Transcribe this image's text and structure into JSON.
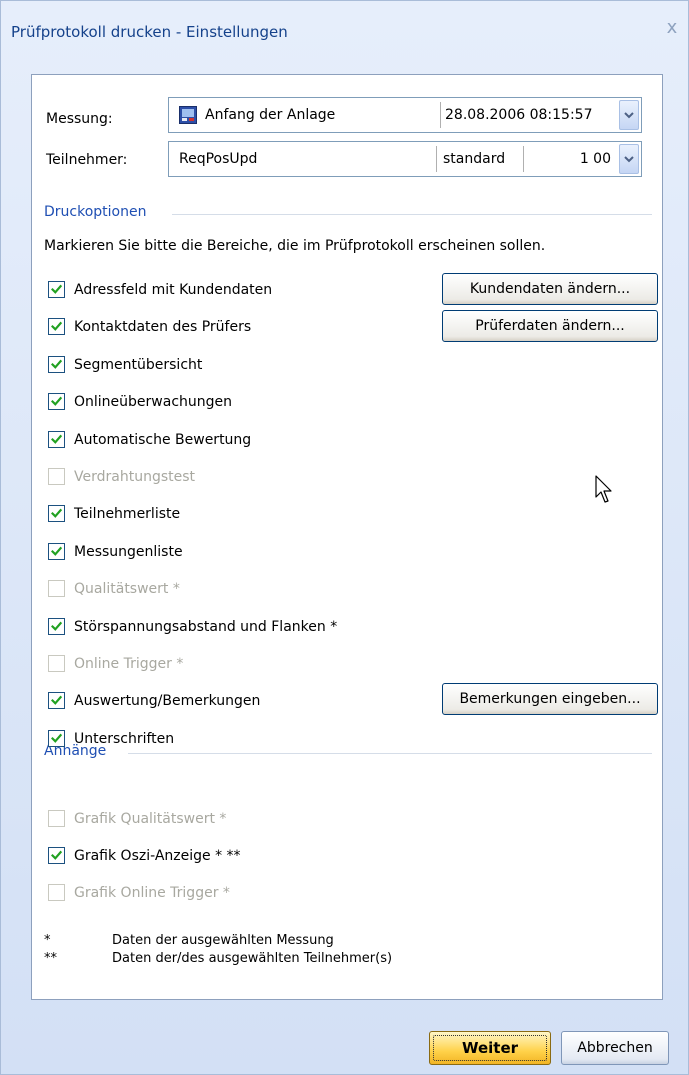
{
  "window": {
    "title": "Prüfprotokoll drucken - Einstellungen",
    "close_glyph": "x"
  },
  "messung": {
    "label": "Messung:",
    "name": "Anfang der Anlage",
    "datetime": "28.08.2006 08:15:57"
  },
  "teilnehmer": {
    "label": "Teilnehmer:",
    "name": "ReqPosUpd",
    "type": "standard",
    "value": "1 00"
  },
  "druckoptionen": {
    "heading": "Druckoptionen",
    "instruction": "Markieren Sie bitte die Bereiche, die im Prüfprotokoll erscheinen sollen.",
    "options": [
      {
        "label": "Adressfeld mit Kundendaten",
        "checked": true,
        "enabled": true
      },
      {
        "label": "Kontaktdaten des Prüfers",
        "checked": true,
        "enabled": true
      },
      {
        "label": "Segmentübersicht",
        "checked": true,
        "enabled": true
      },
      {
        "label": "Onlineüberwachungen",
        "checked": true,
        "enabled": true
      },
      {
        "label": "Automatische Bewertung",
        "checked": true,
        "enabled": true
      },
      {
        "label": "Verdrahtungstest",
        "checked": false,
        "enabled": false
      },
      {
        "label": "Teilnehmerliste",
        "checked": true,
        "enabled": true
      },
      {
        "label": "Messungenliste",
        "checked": true,
        "enabled": true
      },
      {
        "label": "Qualitätswert *",
        "checked": false,
        "enabled": false
      },
      {
        "label": "Störspannungsabstand und Flanken *",
        "checked": true,
        "enabled": true
      },
      {
        "label": "Online Trigger *",
        "checked": false,
        "enabled": false
      },
      {
        "label": "Auswertung/Bemerkungen",
        "checked": true,
        "enabled": true
      },
      {
        "label": "Unterschriften",
        "checked": true,
        "enabled": true
      }
    ],
    "buttons": {
      "kundendaten": "Kundendaten ändern...",
      "pruferdaten": "Prüferdaten ändern...",
      "bemerkungen": "Bemerkungen eingeben..."
    }
  },
  "anhaenge": {
    "heading": "Anhänge",
    "options": [
      {
        "label": "Grafik Qualitätswert *",
        "checked": false,
        "enabled": false
      },
      {
        "label": "Grafik Oszi-Anzeige * **",
        "checked": true,
        "enabled": true
      },
      {
        "label": "Grafik Online Trigger *",
        "checked": false,
        "enabled": false
      }
    ]
  },
  "footnotes": [
    {
      "mark": "*",
      "text": "Daten der ausgewählten Messung"
    },
    {
      "mark": "**",
      "text": "Daten der/des ausgewählten Teilnehmer(s)"
    }
  ],
  "footer": {
    "weiter": "Weiter",
    "abbrechen": "Abbrechen"
  },
  "colors": {
    "accent": "#1f4fb3",
    "check": "#21a121",
    "primary_button": "#ffd24a"
  },
  "icons": {
    "messung": "measurement-icon",
    "dropdown": "chevron-down-icon",
    "checkmark": "checkmark-icon",
    "cursor": "mouse-pointer-icon"
  }
}
